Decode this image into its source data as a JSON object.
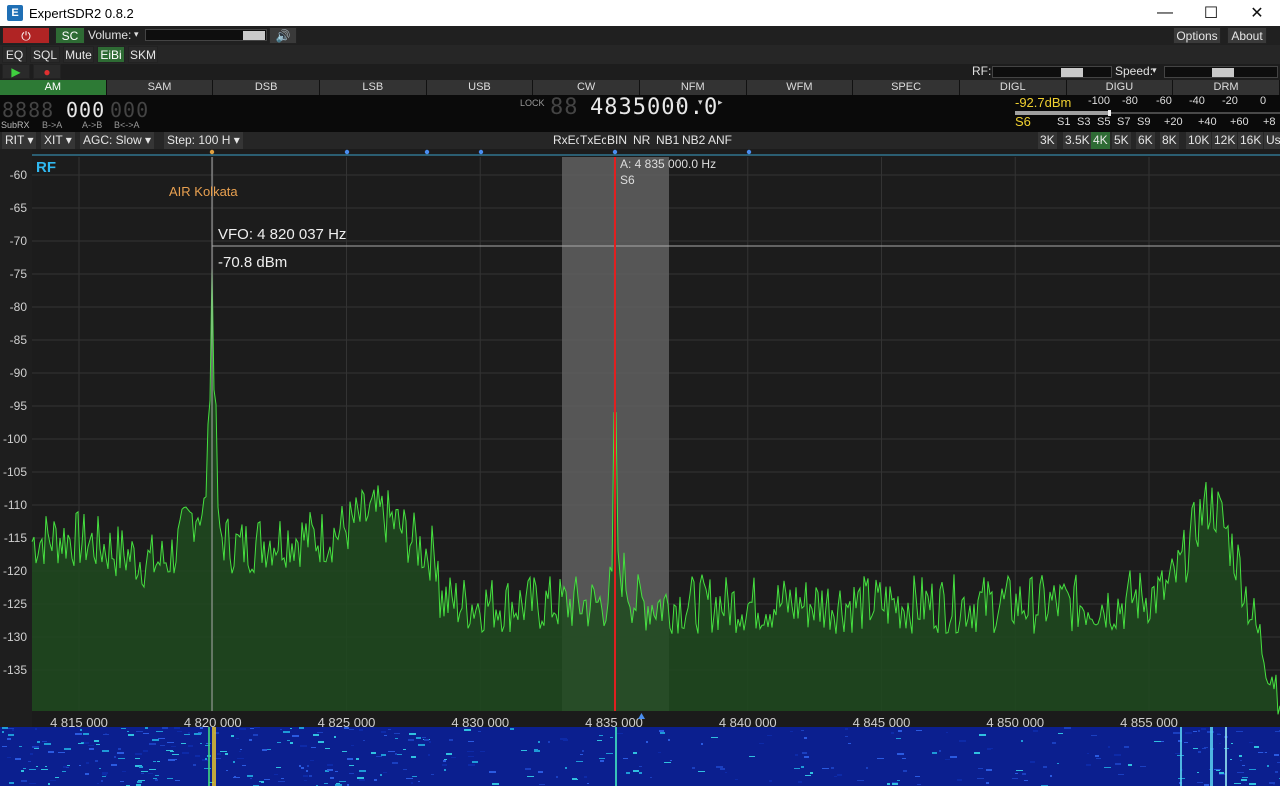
{
  "window": {
    "title": "ExpertSDR2 0.8.2",
    "minimize": "—",
    "maximize": "☐",
    "close": "✕"
  },
  "toolbar": {
    "power_icon": "power-icon",
    "sc": "SC",
    "volume_label": "Volume:",
    "speaker_icon": "speaker-icon",
    "options": "Options",
    "about": "About",
    "eq": "EQ",
    "sql": "SQL",
    "mute": "Mute",
    "eibi": "EiBi",
    "skm": "SKM",
    "rf_label": "RF:",
    "speed_label": "Speed:"
  },
  "modes": [
    "AM",
    "SAM",
    "DSB",
    "LSB",
    "USB",
    "CW",
    "NFM",
    "WFM",
    "SPEC",
    "DIGL",
    "DIGU",
    "DRM"
  ],
  "active_mode": "AM",
  "freq": {
    "sub_main": "000",
    "sub_label": "SubRX",
    "sub_btns": [
      "B->A",
      "A->B",
      "B<->A"
    ],
    "lock": "LOCK",
    "main": "4835000.0"
  },
  "smeter": {
    "level": "-92.7dBm",
    "s_unit": "S6",
    "scale_top": [
      "-100",
      "-80",
      "-60",
      "-40",
      "-20",
      "0"
    ],
    "scale_bottom": [
      "S1",
      "S3",
      "S5",
      "S7",
      "S9",
      "+20",
      "+40",
      "+60",
      "+8"
    ]
  },
  "controls": {
    "rit": "RIT",
    "xit": "XIT",
    "agc": "AGC: Slow",
    "step": "Step: 100 H",
    "dsp": [
      "RxEc",
      "TxEc",
      "BIN",
      "NR",
      "NB1",
      "NB2",
      "ANF"
    ],
    "filters": [
      "3K",
      "3.5K",
      "4K",
      "5K",
      "6K",
      "8K",
      "10K",
      "12K",
      "16K",
      "Use"
    ],
    "active_filter": "4K"
  },
  "spectrum": {
    "rf_label": "RF",
    "station_label": "AIR Kolkata",
    "vfo_label": "VFO: 4 820 037 Hz",
    "vfo_level": "-70.8 dBm",
    "cursor_label": "A: 4 835 000.0 Hz",
    "cursor_s": "S6",
    "y_ticks": [
      "-60",
      "-65",
      "-70",
      "-75",
      "-80",
      "-85",
      "-90",
      "-95",
      "-100",
      "-105",
      "-110",
      "-115",
      "-120",
      "-125",
      "-130",
      "-135"
    ],
    "x_ticks": [
      "4 815 000",
      "4 820 000",
      "4 825 000",
      "4 830 000",
      "4 835 000",
      "4 840 000",
      "4 845 000",
      "4 850 000",
      "4 855 000"
    ],
    "colors": {
      "trace": "#46e040",
      "fill": "#1f4a1f",
      "cursor": "#e02020",
      "passband": "#6a6a6a"
    }
  }
}
